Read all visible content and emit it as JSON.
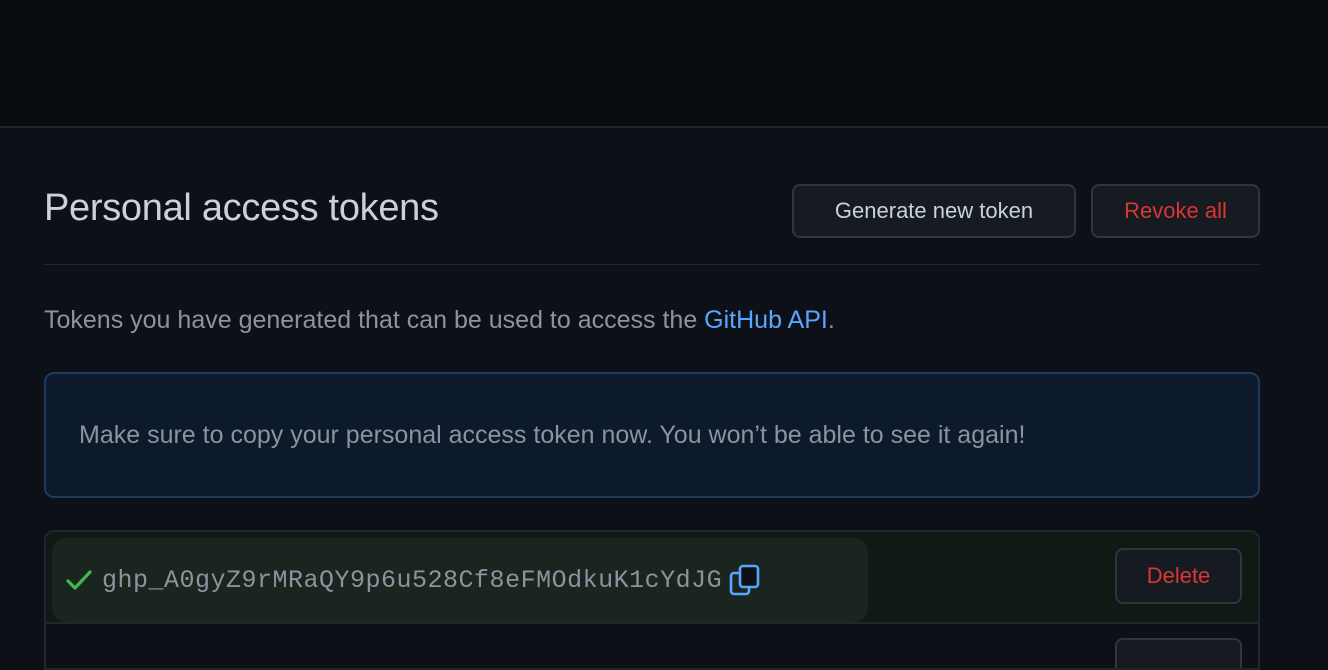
{
  "page": {
    "title": "Personal access tokens",
    "description_prefix": "Tokens you have generated that can be used to access the ",
    "description_link": "GitHub API",
    "description_suffix": "."
  },
  "actions": {
    "generate_label": "Generate new token",
    "revoke_label": "Revoke all"
  },
  "flash": {
    "message": "Make sure to copy your personal access token now. You won’t be able to see it again!"
  },
  "tokens": [
    {
      "value": "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",
      "delete_label": "Delete",
      "status_icon": "check-icon",
      "copy_icon": "copy-icon"
    }
  ],
  "colors": {
    "background": "#0d1117",
    "link": "#58a6ff",
    "danger": "#da3633",
    "success": "#3fb950",
    "flash_border": "#1f3a5f"
  }
}
